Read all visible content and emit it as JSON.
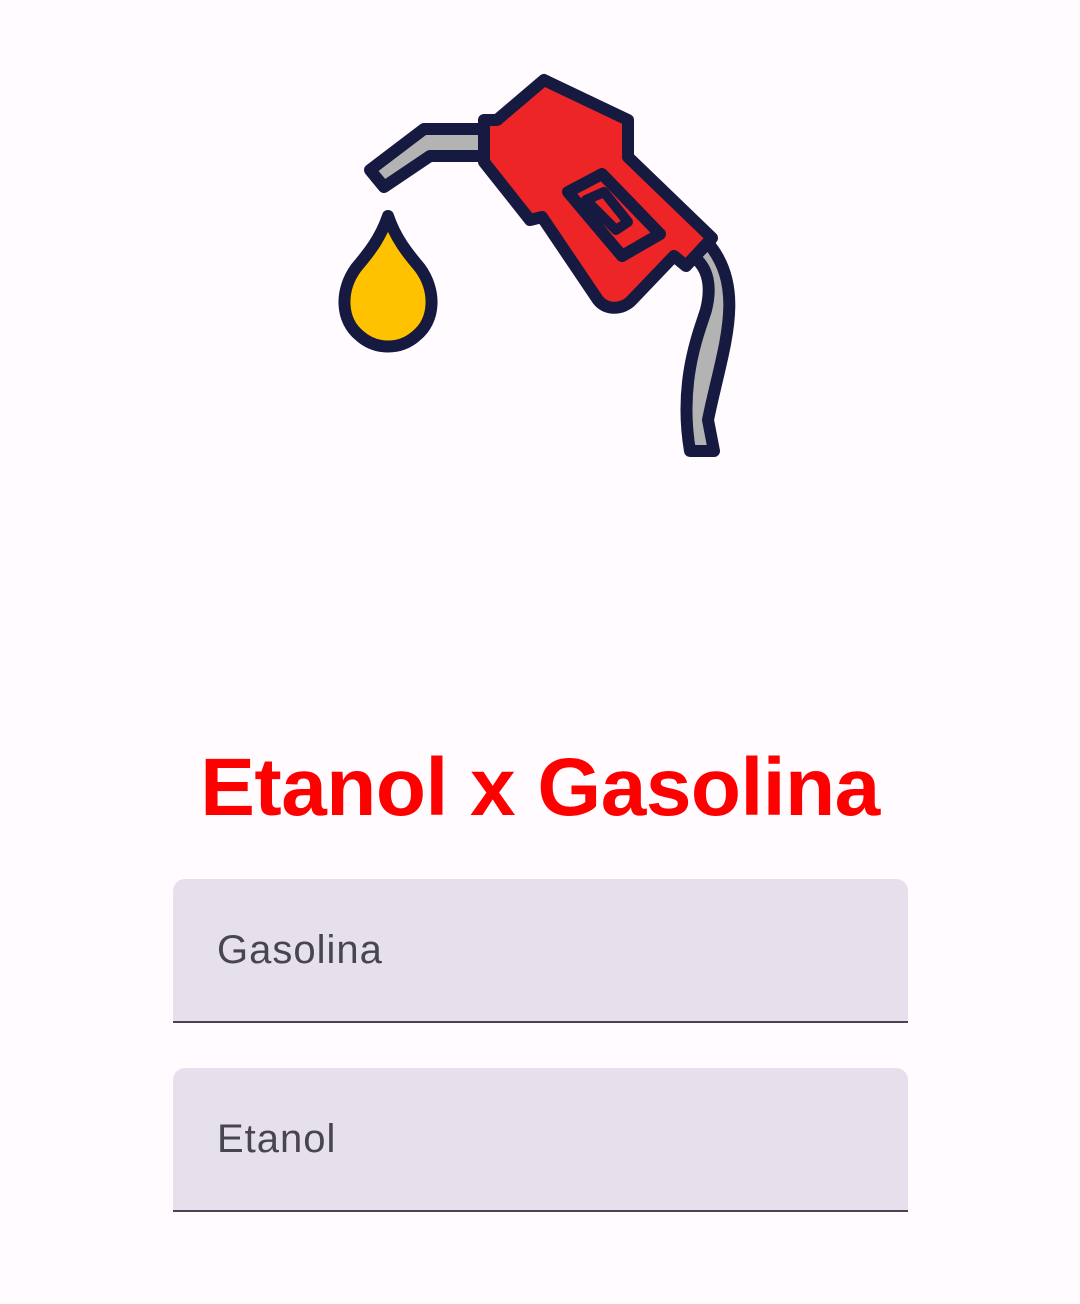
{
  "logo": {
    "icon": "fuel-pump-nozzle-icon",
    "colors": {
      "outline": "#161a40",
      "nozzle_body": "#EE2526",
      "drop": "#FFC200",
      "spout": "#B3B3B3"
    }
  },
  "title": "Etanol x Gasolina",
  "colors": {
    "title": "#FF0000",
    "background": "#FFFBFE",
    "field_fill": "#E6E0EC",
    "field_underline": "#49454F"
  },
  "form": {
    "gasolina": {
      "placeholder": "Gasolina",
      "value": ""
    },
    "etanol": {
      "placeholder": "Etanol",
      "value": ""
    }
  }
}
